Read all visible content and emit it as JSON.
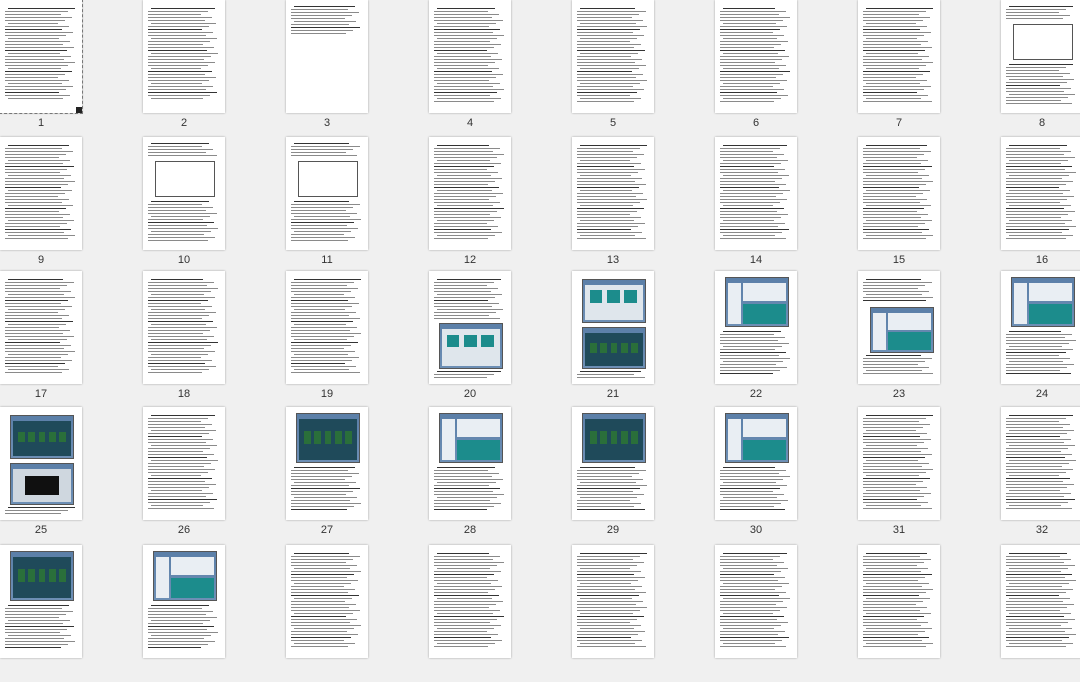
{
  "viewer": {
    "pages": [
      {
        "n": "1",
        "kind": "toc"
      },
      {
        "n": "2",
        "kind": "toc"
      },
      {
        "n": "3",
        "kind": "toc-short"
      },
      {
        "n": "4",
        "kind": "text"
      },
      {
        "n": "5",
        "kind": "text"
      },
      {
        "n": "6",
        "kind": "text"
      },
      {
        "n": "7",
        "kind": "text"
      },
      {
        "n": "8",
        "kind": "diagram"
      },
      {
        "n": "9",
        "kind": "text"
      },
      {
        "n": "10",
        "kind": "diagram"
      },
      {
        "n": "11",
        "kind": "diagram"
      },
      {
        "n": "12",
        "kind": "text"
      },
      {
        "n": "13",
        "kind": "text"
      },
      {
        "n": "14",
        "kind": "text"
      },
      {
        "n": "15",
        "kind": "text"
      },
      {
        "n": "16",
        "kind": "text"
      },
      {
        "n": "17",
        "kind": "text"
      },
      {
        "n": "18",
        "kind": "text"
      },
      {
        "n": "19",
        "kind": "text"
      },
      {
        "n": "20",
        "kind": "screenshot-bottom"
      },
      {
        "n": "21",
        "kind": "screenshot-double"
      },
      {
        "n": "22",
        "kind": "screenshot-top"
      },
      {
        "n": "23",
        "kind": "screenshot-mid"
      },
      {
        "n": "24",
        "kind": "screenshot-top"
      },
      {
        "n": "25",
        "kind": "screenshot-double"
      },
      {
        "n": "26",
        "kind": "text"
      },
      {
        "n": "27",
        "kind": "screenshot-top"
      },
      {
        "n": "28",
        "kind": "screenshot-top"
      },
      {
        "n": "29",
        "kind": "screenshot-top"
      },
      {
        "n": "30",
        "kind": "screenshot-top"
      },
      {
        "n": "31",
        "kind": "text"
      },
      {
        "n": "32",
        "kind": "text"
      },
      {
        "n": "",
        "kind": "screenshot-top"
      },
      {
        "n": "",
        "kind": "screenshot-top"
      },
      {
        "n": "",
        "kind": "text"
      },
      {
        "n": "",
        "kind": "text"
      },
      {
        "n": "",
        "kind": "text"
      },
      {
        "n": "",
        "kind": "text"
      },
      {
        "n": "",
        "kind": "text"
      },
      {
        "n": "",
        "kind": "text"
      }
    ],
    "selected_page": "1",
    "colors": {
      "background": "#f0f0f0",
      "page": "#ffffff",
      "screenshot_teal": "#1c8c8c",
      "screenshot_blue": "#5b7fa8"
    }
  }
}
